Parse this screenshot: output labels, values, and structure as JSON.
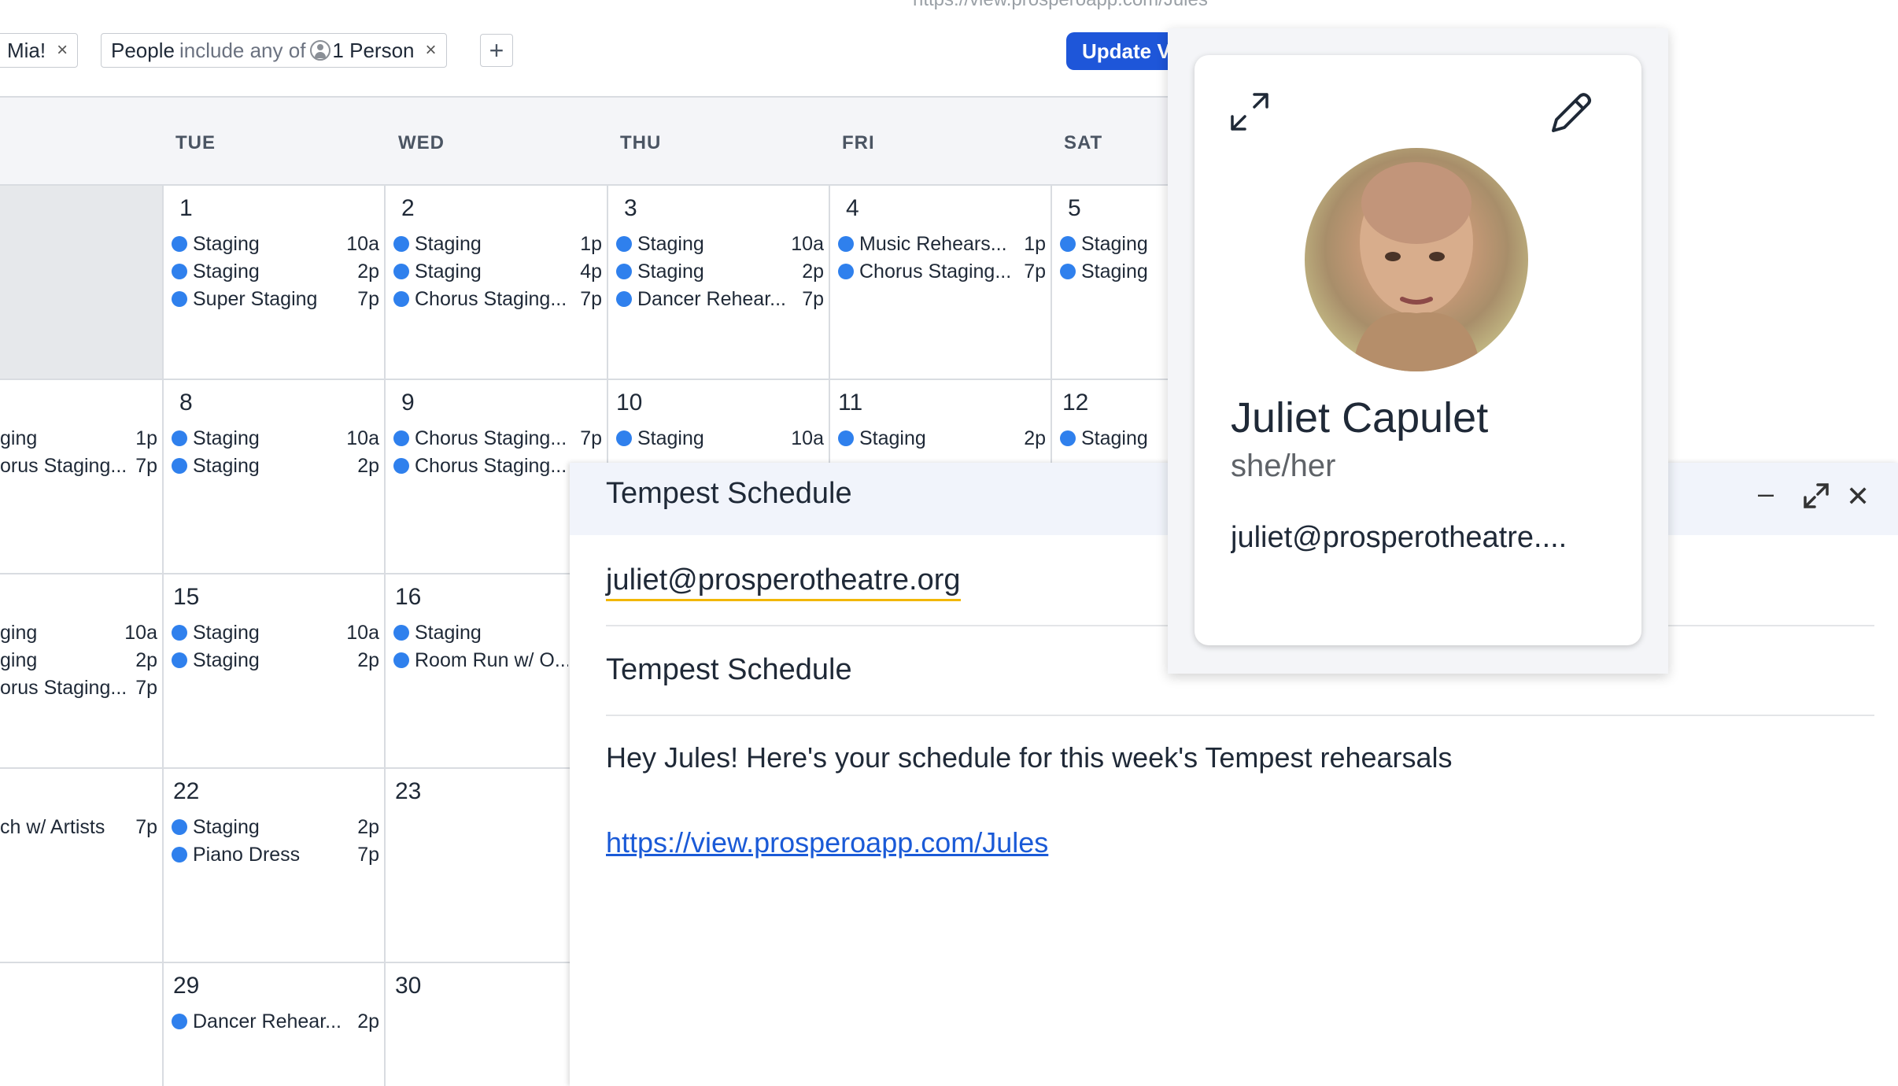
{
  "url_hint": "https://view.prosperoapp.com/Jules",
  "filters": {
    "chip1_label": "Mia!",
    "chip2_prefix": "People",
    "chip2_op": "include any of",
    "chip2_value": "1 Person",
    "remove_glyph": "×",
    "add_glyph": "+",
    "update_label": "Update View"
  },
  "calendar": {
    "days": [
      "TUE",
      "WED",
      "THU",
      "FRI",
      "SAT"
    ],
    "week1": {
      "d1": {
        "num": "1",
        "e": [
          [
            "Staging",
            "10a"
          ],
          [
            "Staging",
            "2p"
          ],
          [
            "Super Staging",
            "7p"
          ]
        ]
      },
      "d2": {
        "num": "2",
        "e": [
          [
            "Staging",
            "1p"
          ],
          [
            "Staging",
            "4p"
          ],
          [
            "Chorus Staging...",
            "7p"
          ]
        ]
      },
      "d3": {
        "num": "3",
        "e": [
          [
            "Staging",
            "10a"
          ],
          [
            "Staging",
            "2p"
          ],
          [
            "Dancer Rehear...",
            "7p"
          ]
        ]
      },
      "d4": {
        "num": "4",
        "e": [
          [
            "Music Rehears...",
            "1p"
          ],
          [
            "Chorus Staging...",
            "7p"
          ]
        ]
      },
      "d5": {
        "num": "5",
        "e": [
          [
            "Staging",
            ""
          ],
          [
            "Staging",
            ""
          ]
        ]
      }
    },
    "week2": {
      "mon": {
        "e": [
          [
            "ging",
            "1p"
          ],
          [
            "orus Staging...",
            "7p"
          ]
        ]
      },
      "d1": {
        "num": "8",
        "e": [
          [
            "Staging",
            "10a"
          ],
          [
            "Staging",
            "2p"
          ]
        ]
      },
      "d2": {
        "num": "9",
        "e": [
          [
            "Chorus Staging...",
            "7p"
          ],
          [
            "Chorus Staging...",
            ""
          ]
        ]
      },
      "d3": {
        "num": "10",
        "e": [
          [
            "Staging",
            "10a"
          ]
        ]
      },
      "d4": {
        "num": "11",
        "e": [
          [
            "Staging",
            "2p"
          ]
        ]
      },
      "d5": {
        "num": "12",
        "e": [
          [
            "Staging",
            ""
          ]
        ]
      }
    },
    "week3": {
      "mon": {
        "e": [
          [
            "ging",
            "10a"
          ],
          [
            "ging",
            "2p"
          ],
          [
            "orus Staging...",
            "7p"
          ]
        ]
      },
      "d1": {
        "num": "15",
        "e": [
          [
            "Staging",
            "10a"
          ],
          [
            "Staging",
            "2p"
          ]
        ]
      },
      "d2": {
        "num": "16",
        "e": [
          [
            "Staging",
            ""
          ],
          [
            "Room Run w/ O...",
            ""
          ]
        ]
      }
    },
    "week4": {
      "mon": {
        "e": [
          [
            "ch w/ Artists",
            "7p"
          ]
        ]
      },
      "d1": {
        "num": "22",
        "e": [
          [
            "Staging",
            "2p"
          ],
          [
            "Piano Dress",
            "7p"
          ]
        ]
      },
      "d2": {
        "num": "23",
        "e": []
      }
    },
    "week5": {
      "d1": {
        "num": "29",
        "e": [
          [
            "Dancer Rehear...",
            "2p"
          ]
        ]
      },
      "d2": {
        "num": "30",
        "e": []
      }
    }
  },
  "compose": {
    "title": "Tempest Schedule",
    "to": "juliet@prosperotheatre.org",
    "subject": "Tempest Schedule",
    "body": "Hey Jules! Here's your schedule for this week's Tempest rehearsals",
    "link": "https://view.prosperoapp.com/Jules",
    "minimize_glyph": "–",
    "close_glyph": "✕"
  },
  "contact": {
    "name": "Juliet Capulet",
    "pronouns": "she/her",
    "email": "juliet@prosperotheatre...."
  },
  "colors": {
    "event_dot": "#2f80ed",
    "primary_button": "#1e56d9",
    "link": "#1a5ad7",
    "to_underline": "#f2b705"
  }
}
